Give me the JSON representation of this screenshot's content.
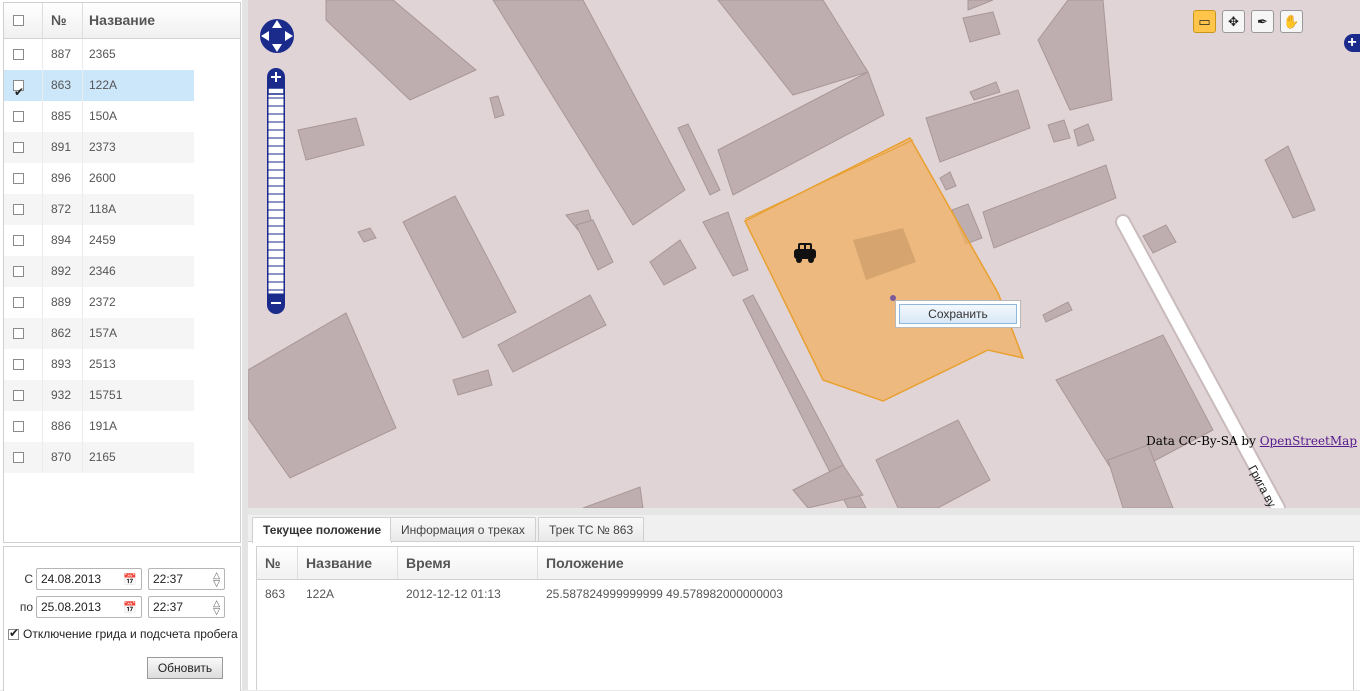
{
  "vehicles": {
    "header": {
      "num": "№",
      "name": "Название"
    },
    "rows": [
      {
        "num": "887",
        "name": "2365",
        "checked": false
      },
      {
        "num": "863",
        "name": "122A",
        "checked": true
      },
      {
        "num": "885",
        "name": "150A",
        "checked": false
      },
      {
        "num": "891",
        "name": "2373",
        "checked": false
      },
      {
        "num": "896",
        "name": "2600",
        "checked": false
      },
      {
        "num": "872",
        "name": "118A",
        "checked": false
      },
      {
        "num": "894",
        "name": "2459",
        "checked": false
      },
      {
        "num": "892",
        "name": "2346",
        "checked": false
      },
      {
        "num": "889",
        "name": "2372",
        "checked": false
      },
      {
        "num": "862",
        "name": "157A",
        "checked": false
      },
      {
        "num": "893",
        "name": "2513",
        "checked": false
      },
      {
        "num": "932",
        "name": "15751",
        "checked": false
      },
      {
        "num": "886",
        "name": "191A",
        "checked": false
      },
      {
        "num": "870",
        "name": "2165",
        "checked": false
      }
    ]
  },
  "filters": {
    "from_label": "С",
    "from_date": "24.08.2013",
    "from_time": "22:37",
    "to_label": "по",
    "to_date": "25.08.2013",
    "to_time": "22:37",
    "option_label": "Отключение грида и подсчета пробега",
    "option_checked": true,
    "refresh_label": "Обновить"
  },
  "map": {
    "attribution_prefix": "Data CC-By-SA by ",
    "attribution_link": "OpenStreetMap",
    "street_label": "Грига ву",
    "popup_save_label": "Сохранить",
    "polygon_fill": "#f0b060",
    "polygon_stroke": "#e8a030",
    "building_color": "#bfaeaf",
    "background_color": "#e1d4d6",
    "nav_color": "#1a2b8c"
  },
  "tabs": [
    {
      "label": "Текущее положение",
      "active": true
    },
    {
      "label": "Информация о треках",
      "active": false
    },
    {
      "label": "Трек ТС № 863",
      "active": false
    }
  ],
  "current": {
    "header": {
      "num": "№",
      "name": "Название",
      "time": "Время",
      "position": "Положение"
    },
    "rows": [
      {
        "num": "863",
        "name": "122A",
        "time": "2012-12-12 01:13",
        "position": "25.587824999999999 49.578982000000003"
      }
    ]
  }
}
